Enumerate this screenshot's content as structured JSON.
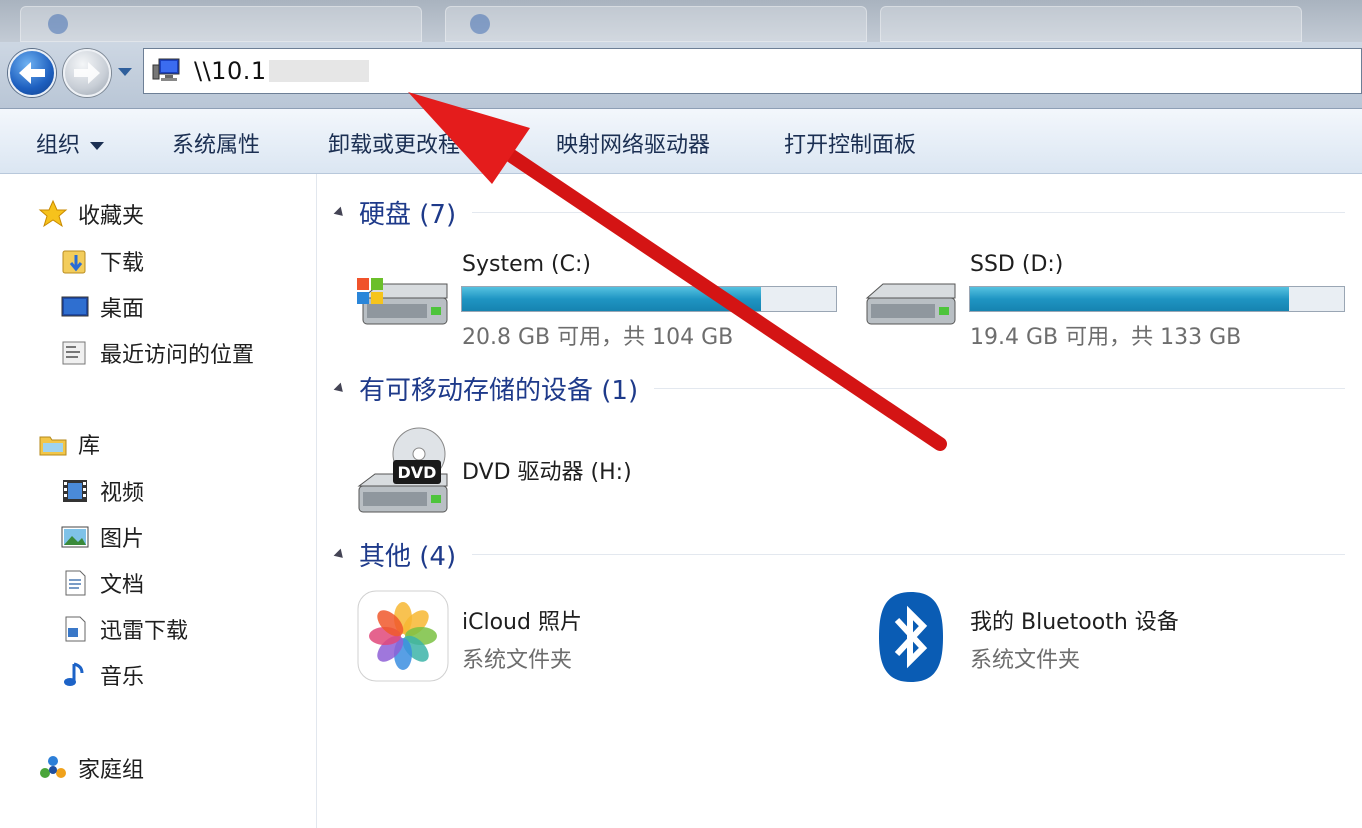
{
  "address_bar": {
    "path": "\\\\10.1"
  },
  "toolbar": {
    "organize": "组织",
    "system_properties": "系统属性",
    "uninstall": "卸载或更改程",
    "map_drive": "映射网络驱动器",
    "control_panel": "打开控制面板"
  },
  "sidebar": {
    "favorites": "收藏夹",
    "downloads": "下载",
    "desktop": "桌面",
    "recent": "最近访问的位置",
    "libraries": "库",
    "videos": "视频",
    "pictures": "图片",
    "documents": "文档",
    "xunlei": "迅雷下载",
    "music": "音乐",
    "homegroup": "家庭组"
  },
  "groups": {
    "hard_disks": "硬盘 (7)",
    "removable": "有可移动存储的设备 (1)",
    "other": "其他 (4)"
  },
  "drives": [
    {
      "name": "System (C:)",
      "free": "20.8 GB 可用，共 104 GB",
      "used_fraction": 0.8
    },
    {
      "name": "SSD (D:)",
      "free": "19.4 GB 可用，共 133 GB",
      "used_fraction": 0.854
    }
  ],
  "dvd": {
    "name": "DVD 驱动器 (H:)",
    "badge": "DVD"
  },
  "other_items": [
    {
      "name": "iCloud 照片",
      "type": "系统文件夹"
    },
    {
      "name": "我的 Bluetooth 设备",
      "type": "系统文件夹"
    }
  ],
  "colors": {
    "group_title": "#1e3a8a",
    "bar_fill": "#1f95c3",
    "annotation_arrow": "#e41c1c",
    "bluetooth": "#0a5cb4"
  }
}
